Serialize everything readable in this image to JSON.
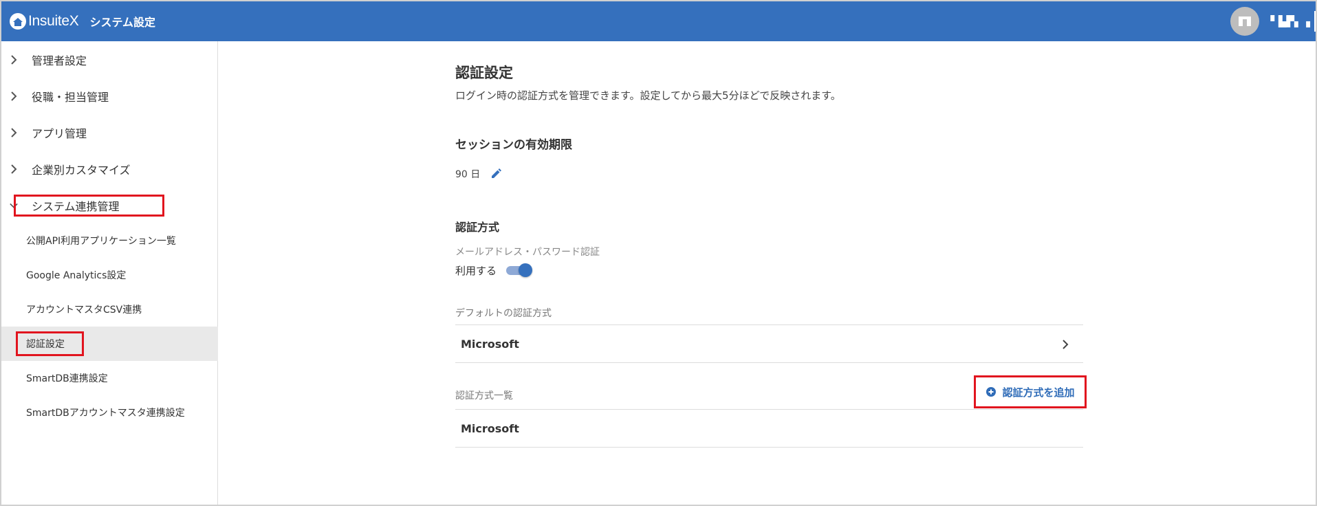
{
  "header": {
    "logo_text": "InsuiteX",
    "title": "システム設定",
    "user_name": "▘▙▛▖▗",
    "brand_color": "#3570bd"
  },
  "sidebar": {
    "items": [
      {
        "label": "管理者設定",
        "icon": "chevron-right-icon"
      },
      {
        "label": "役職・担当管理",
        "icon": "chevron-right-icon"
      },
      {
        "label": "アプリ管理",
        "icon": "chevron-right-icon"
      },
      {
        "label": "企業別カスタマイズ",
        "icon": "chevron-right-icon"
      },
      {
        "label": "システム連携管理",
        "icon": "chevron-down-icon",
        "expanded": true
      }
    ],
    "subitems": [
      {
        "label": "公開API利用アプリケーション一覧"
      },
      {
        "label": "Google Analytics設定"
      },
      {
        "label": "アカウントマスタCSV連携"
      },
      {
        "label": "認証設定",
        "active": true
      },
      {
        "label": "SmartDB連携設定"
      },
      {
        "label": "SmartDBアカウントマスタ連携設定"
      }
    ]
  },
  "main": {
    "title": "認証設定",
    "description": "ログイン時の認証方式を管理できます。設定してから最大5分ほどで反映されます。",
    "session": {
      "title": "セッションの有効期限",
      "value": "90 日"
    },
    "auth": {
      "title": "認証方式",
      "method_label": "メールアドレス・パスワード認証",
      "toggle_label": "利用する",
      "toggle_on": true,
      "default_label": "デフォルトの認証方式",
      "default_value": "Microsoft",
      "list_label": "認証方式一覧",
      "add_button": "認証方式を追加",
      "list_items": [
        "Microsoft"
      ]
    }
  },
  "highlight_color": "#e1141e"
}
